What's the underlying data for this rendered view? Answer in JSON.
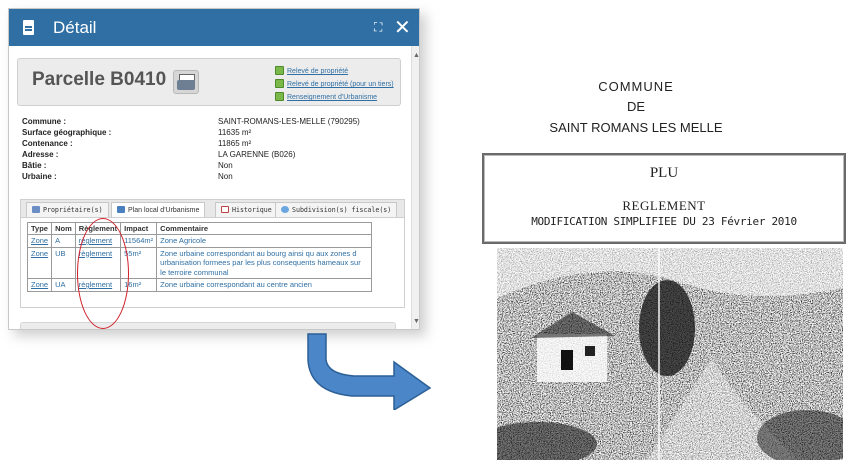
{
  "panel": {
    "title": "Détail",
    "expand_symbol": "⛶",
    "close_symbol": "✕",
    "scroll_up": "▲",
    "scroll_down": "▼",
    "parcel_title": "Parcelle B0410",
    "links": [
      "Relevé de propriété",
      "Relevé de propriété (pour un tiers)",
      "Renseignement d'Urbanisme"
    ],
    "properties": [
      {
        "label": "Commune :",
        "value": "SAINT-ROMANS-LES-MELLE (790295)"
      },
      {
        "label": "Surface géographique :",
        "value": "11635 m²"
      },
      {
        "label": "Contenance :",
        "value": "11865 m²"
      },
      {
        "label": "Adresse :",
        "value": "LA GARENNE (B026)"
      },
      {
        "label": "Bâtie :",
        "value": "Non"
      },
      {
        "label": "Urbaine :",
        "value": "Non"
      }
    ],
    "tabs": [
      "Propriétaire(s)",
      "Plan local d'Urbanisme",
      "Historique",
      "Subdivision(s) fiscale(s)"
    ],
    "table": {
      "headers": [
        "Type",
        "Nom",
        "Règlement",
        "Impact",
        "Commentaire"
      ],
      "rows": [
        [
          "Zone",
          "A",
          "règlement",
          "11564m²",
          "Zone Agricole"
        ],
        [
          "Zone",
          "UB",
          "règlement",
          "55m²",
          "Zone urbaine correspondant au bourg ainsi qu aux zones d urbanisation formees par les plus consequents hameaux sur le terroire communal"
        ],
        [
          "Zone",
          "UA",
          "règlement",
          "16m²",
          "Zone urbaine correspondant au centre ancien"
        ]
      ]
    }
  },
  "document": {
    "line1": "COMMUNE",
    "line2": "DE",
    "line3": "SAINT ROMANS LES MELLE",
    "plu": "PLU",
    "reglement": "REGLEMENT",
    "modification": "MODIFICATION SIMPLIFIEE DU 23 Février 2010"
  },
  "colors": {
    "header_blue": "#2f6fa3",
    "link_blue": "#2f6fa3",
    "highlight_red": "#d0202a",
    "arrow_blue": "#4a86c8"
  }
}
